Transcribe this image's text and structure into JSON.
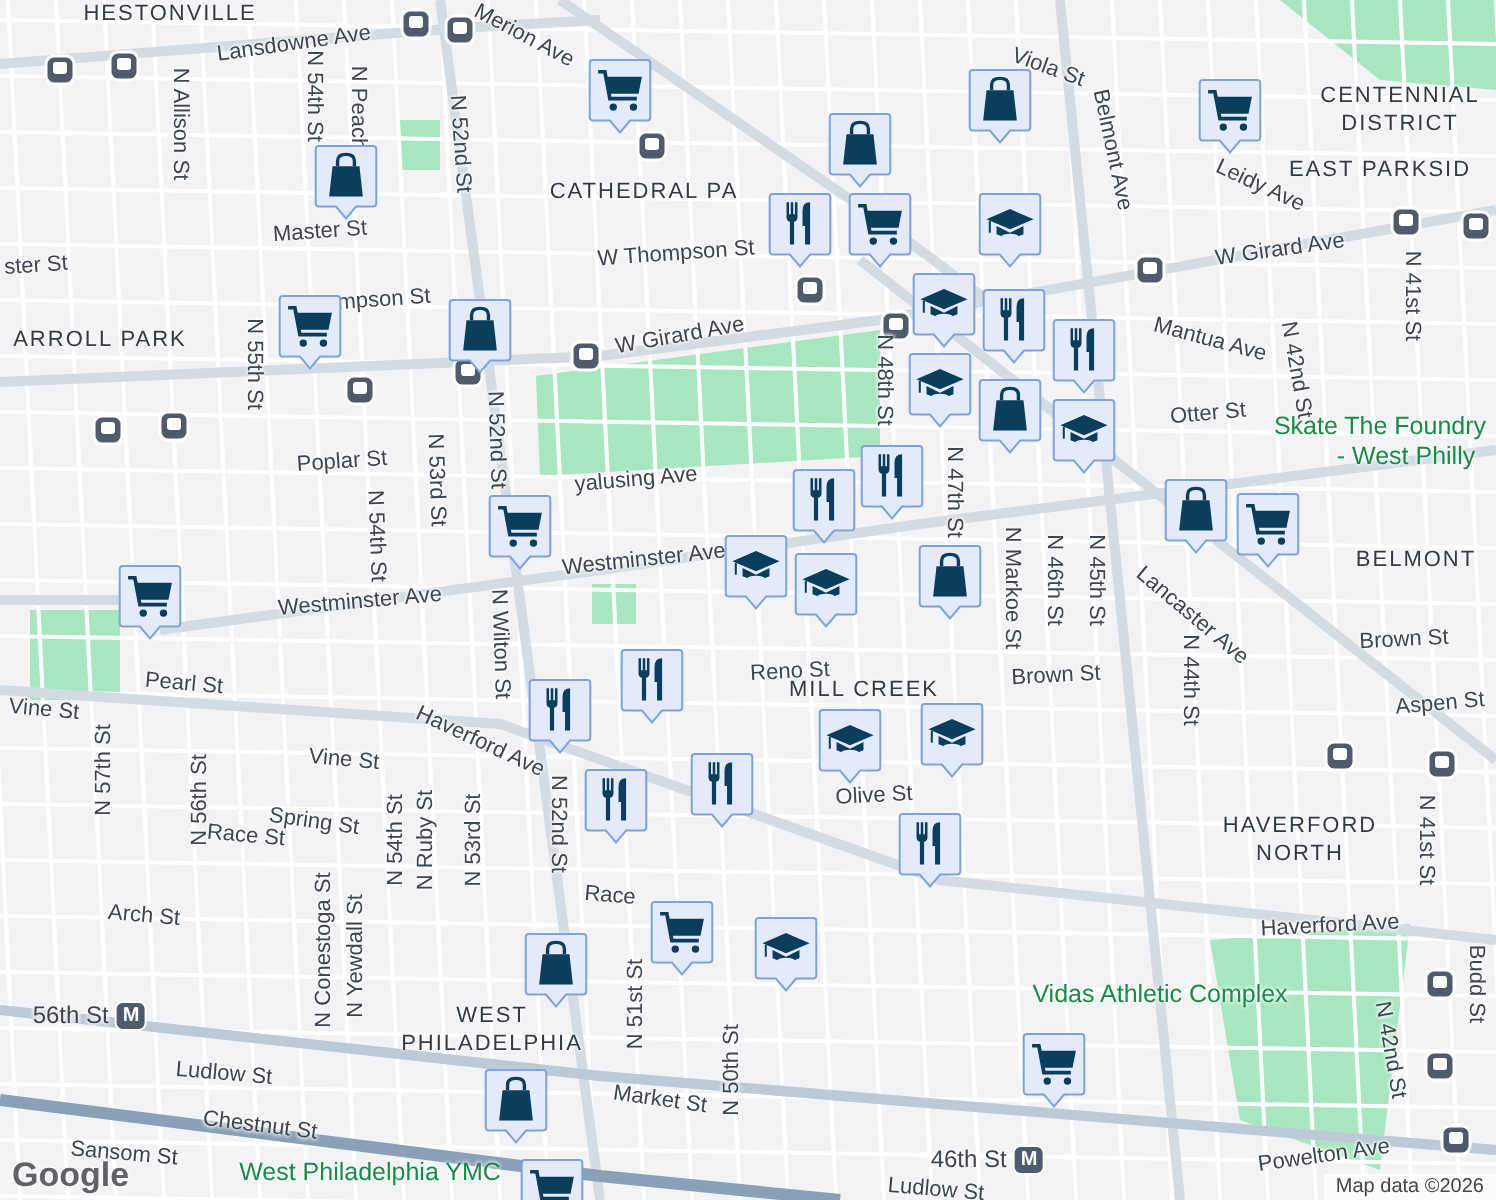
{
  "map": {
    "labels": [
      {
        "text": "HESTONVILLE",
        "kind": "area"
      },
      {
        "text": "Lansdowne Ave",
        "kind": "street"
      },
      {
        "text": "Merion Ave",
        "kind": "street"
      },
      {
        "text": "N Allison St",
        "kind": "street"
      },
      {
        "text": "N 54th St",
        "kind": "street"
      },
      {
        "text": "N Peach",
        "kind": "street"
      },
      {
        "text": "N 52nd St",
        "kind": "street"
      },
      {
        "text": "CATHEDRAL PA",
        "kind": "area"
      },
      {
        "text": "Master St",
        "kind": "street"
      },
      {
        "text": "ster St",
        "kind": "street"
      },
      {
        "text": "W Thompson St",
        "kind": "street"
      },
      {
        "text": "mpson St",
        "kind": "street"
      },
      {
        "text": "ARROLL PARK",
        "kind": "area"
      },
      {
        "text": "N 55th St",
        "kind": "street"
      },
      {
        "text": "W Girard Ave",
        "kind": "street"
      },
      {
        "text": "W Girard Ave",
        "kind": "street"
      },
      {
        "text": "Poplar St",
        "kind": "street"
      },
      {
        "text": "N 53rd St",
        "kind": "street"
      },
      {
        "text": "N 54th St",
        "kind": "street"
      },
      {
        "text": "N 52nd St",
        "kind": "street"
      },
      {
        "text": "yalusing Ave",
        "kind": "street"
      },
      {
        "text": "Westminster Ave",
        "kind": "street"
      },
      {
        "text": "Westminster Ave",
        "kind": "street"
      },
      {
        "text": "Viola St",
        "kind": "street"
      },
      {
        "text": "Belmont Ave",
        "kind": "street"
      },
      {
        "text": "Leidy Ave",
        "kind": "street"
      },
      {
        "text": "CENTENNIAL",
        "kind": "area"
      },
      {
        "text": "DISTRICT",
        "kind": "area"
      },
      {
        "text": "EAST PARKSID",
        "kind": "area"
      },
      {
        "text": "Mantua Ave",
        "kind": "street"
      },
      {
        "text": "N 42nd St",
        "kind": "street"
      },
      {
        "text": "N 41st St",
        "kind": "street"
      },
      {
        "text": "Otter St",
        "kind": "street"
      },
      {
        "text": "Skate The Foundry",
        "kind": "place"
      },
      {
        "text": "- West Philly",
        "kind": "place"
      },
      {
        "text": "BELMONT",
        "kind": "area"
      },
      {
        "text": "Lancaster Ave",
        "kind": "street"
      },
      {
        "text": "N 48th St",
        "kind": "street"
      },
      {
        "text": "N 47th St",
        "kind": "street"
      },
      {
        "text": "N Markoe St",
        "kind": "street"
      },
      {
        "text": "N 46th St",
        "kind": "street"
      },
      {
        "text": "N 45th St",
        "kind": "street"
      },
      {
        "text": "N 44th St",
        "kind": "street"
      },
      {
        "text": "Brown St",
        "kind": "street"
      },
      {
        "text": "Brown St",
        "kind": "street"
      },
      {
        "text": "Aspen St",
        "kind": "street"
      },
      {
        "text": "Reno St",
        "kind": "street"
      },
      {
        "text": "MILL CREEK",
        "kind": "area"
      },
      {
        "text": "Pearl St",
        "kind": "street"
      },
      {
        "text": "Vine St",
        "kind": "street"
      },
      {
        "text": "Vine St",
        "kind": "street"
      },
      {
        "text": "Haverford Ave",
        "kind": "street"
      },
      {
        "text": "Haverford Ave",
        "kind": "street"
      },
      {
        "text": "HAVERFORD",
        "kind": "area"
      },
      {
        "text": "NORTH",
        "kind": "area"
      },
      {
        "text": "N 41st St",
        "kind": "street"
      },
      {
        "text": "Budd St",
        "kind": "street"
      },
      {
        "text": "N 42nd St",
        "kind": "street"
      },
      {
        "text": "Olive St",
        "kind": "street"
      },
      {
        "text": "N Wilton St",
        "kind": "street"
      },
      {
        "text": "N 57th St",
        "kind": "street"
      },
      {
        "text": "N 56th St",
        "kind": "street"
      },
      {
        "text": "Spring St",
        "kind": "street"
      },
      {
        "text": "Race St",
        "kind": "street"
      },
      {
        "text": "Race",
        "kind": "street"
      },
      {
        "text": "N 54th St",
        "kind": "street"
      },
      {
        "text": "N Ruby St",
        "kind": "street"
      },
      {
        "text": "N 53rd St",
        "kind": "street"
      },
      {
        "text": "N 52nd St",
        "kind": "street"
      },
      {
        "text": "Arch St",
        "kind": "street"
      },
      {
        "text": "N Conestoga St",
        "kind": "street"
      },
      {
        "text": "N Yewdall St",
        "kind": "street"
      },
      {
        "text": "WEST",
        "kind": "area"
      },
      {
        "text": "PHILADELPHIA",
        "kind": "area"
      },
      {
        "text": "Market St",
        "kind": "street"
      },
      {
        "text": "Ludlow St",
        "kind": "street"
      },
      {
        "text": "Chestnut St",
        "kind": "street"
      },
      {
        "text": "Sansom St",
        "kind": "street"
      },
      {
        "text": "West Philadelphia YMC",
        "kind": "place"
      },
      {
        "text": "Vidas Athletic Complex",
        "kind": "place"
      },
      {
        "text": "Powelton Ave",
        "kind": "street"
      },
      {
        "text": "N 51st St",
        "kind": "street"
      },
      {
        "text": "N 50th St",
        "kind": "street"
      },
      {
        "text": "Ludlow St",
        "kind": "street"
      },
      {
        "text": "56th St",
        "kind": "metro",
        "badge": "M"
      },
      {
        "text": "46th St",
        "kind": "metro",
        "badge": "M"
      }
    ],
    "pins": [
      {
        "kind": "cart"
      },
      {
        "kind": "bag"
      },
      {
        "kind": "cart"
      },
      {
        "kind": "bag"
      },
      {
        "kind": "bag"
      },
      {
        "kind": "food"
      },
      {
        "kind": "cart"
      },
      {
        "kind": "school"
      },
      {
        "kind": "cart"
      },
      {
        "kind": "bag"
      },
      {
        "kind": "school"
      },
      {
        "kind": "food"
      },
      {
        "kind": "food"
      },
      {
        "kind": "school"
      },
      {
        "kind": "bag"
      },
      {
        "kind": "school"
      },
      {
        "kind": "food"
      },
      {
        "kind": "food"
      },
      {
        "kind": "cart"
      },
      {
        "kind": "school"
      },
      {
        "kind": "school"
      },
      {
        "kind": "bag"
      },
      {
        "kind": "bag"
      },
      {
        "kind": "cart"
      },
      {
        "kind": "cart"
      },
      {
        "kind": "food"
      },
      {
        "kind": "food"
      },
      {
        "kind": "food"
      },
      {
        "kind": "food"
      },
      {
        "kind": "school"
      },
      {
        "kind": "school"
      },
      {
        "kind": "food"
      },
      {
        "kind": "cart"
      },
      {
        "kind": "school"
      },
      {
        "kind": "bag"
      },
      {
        "kind": "bag"
      },
      {
        "kind": "cart"
      },
      {
        "kind": "cart"
      }
    ],
    "logo": "Google",
    "attribution": "Map data ©2026"
  }
}
